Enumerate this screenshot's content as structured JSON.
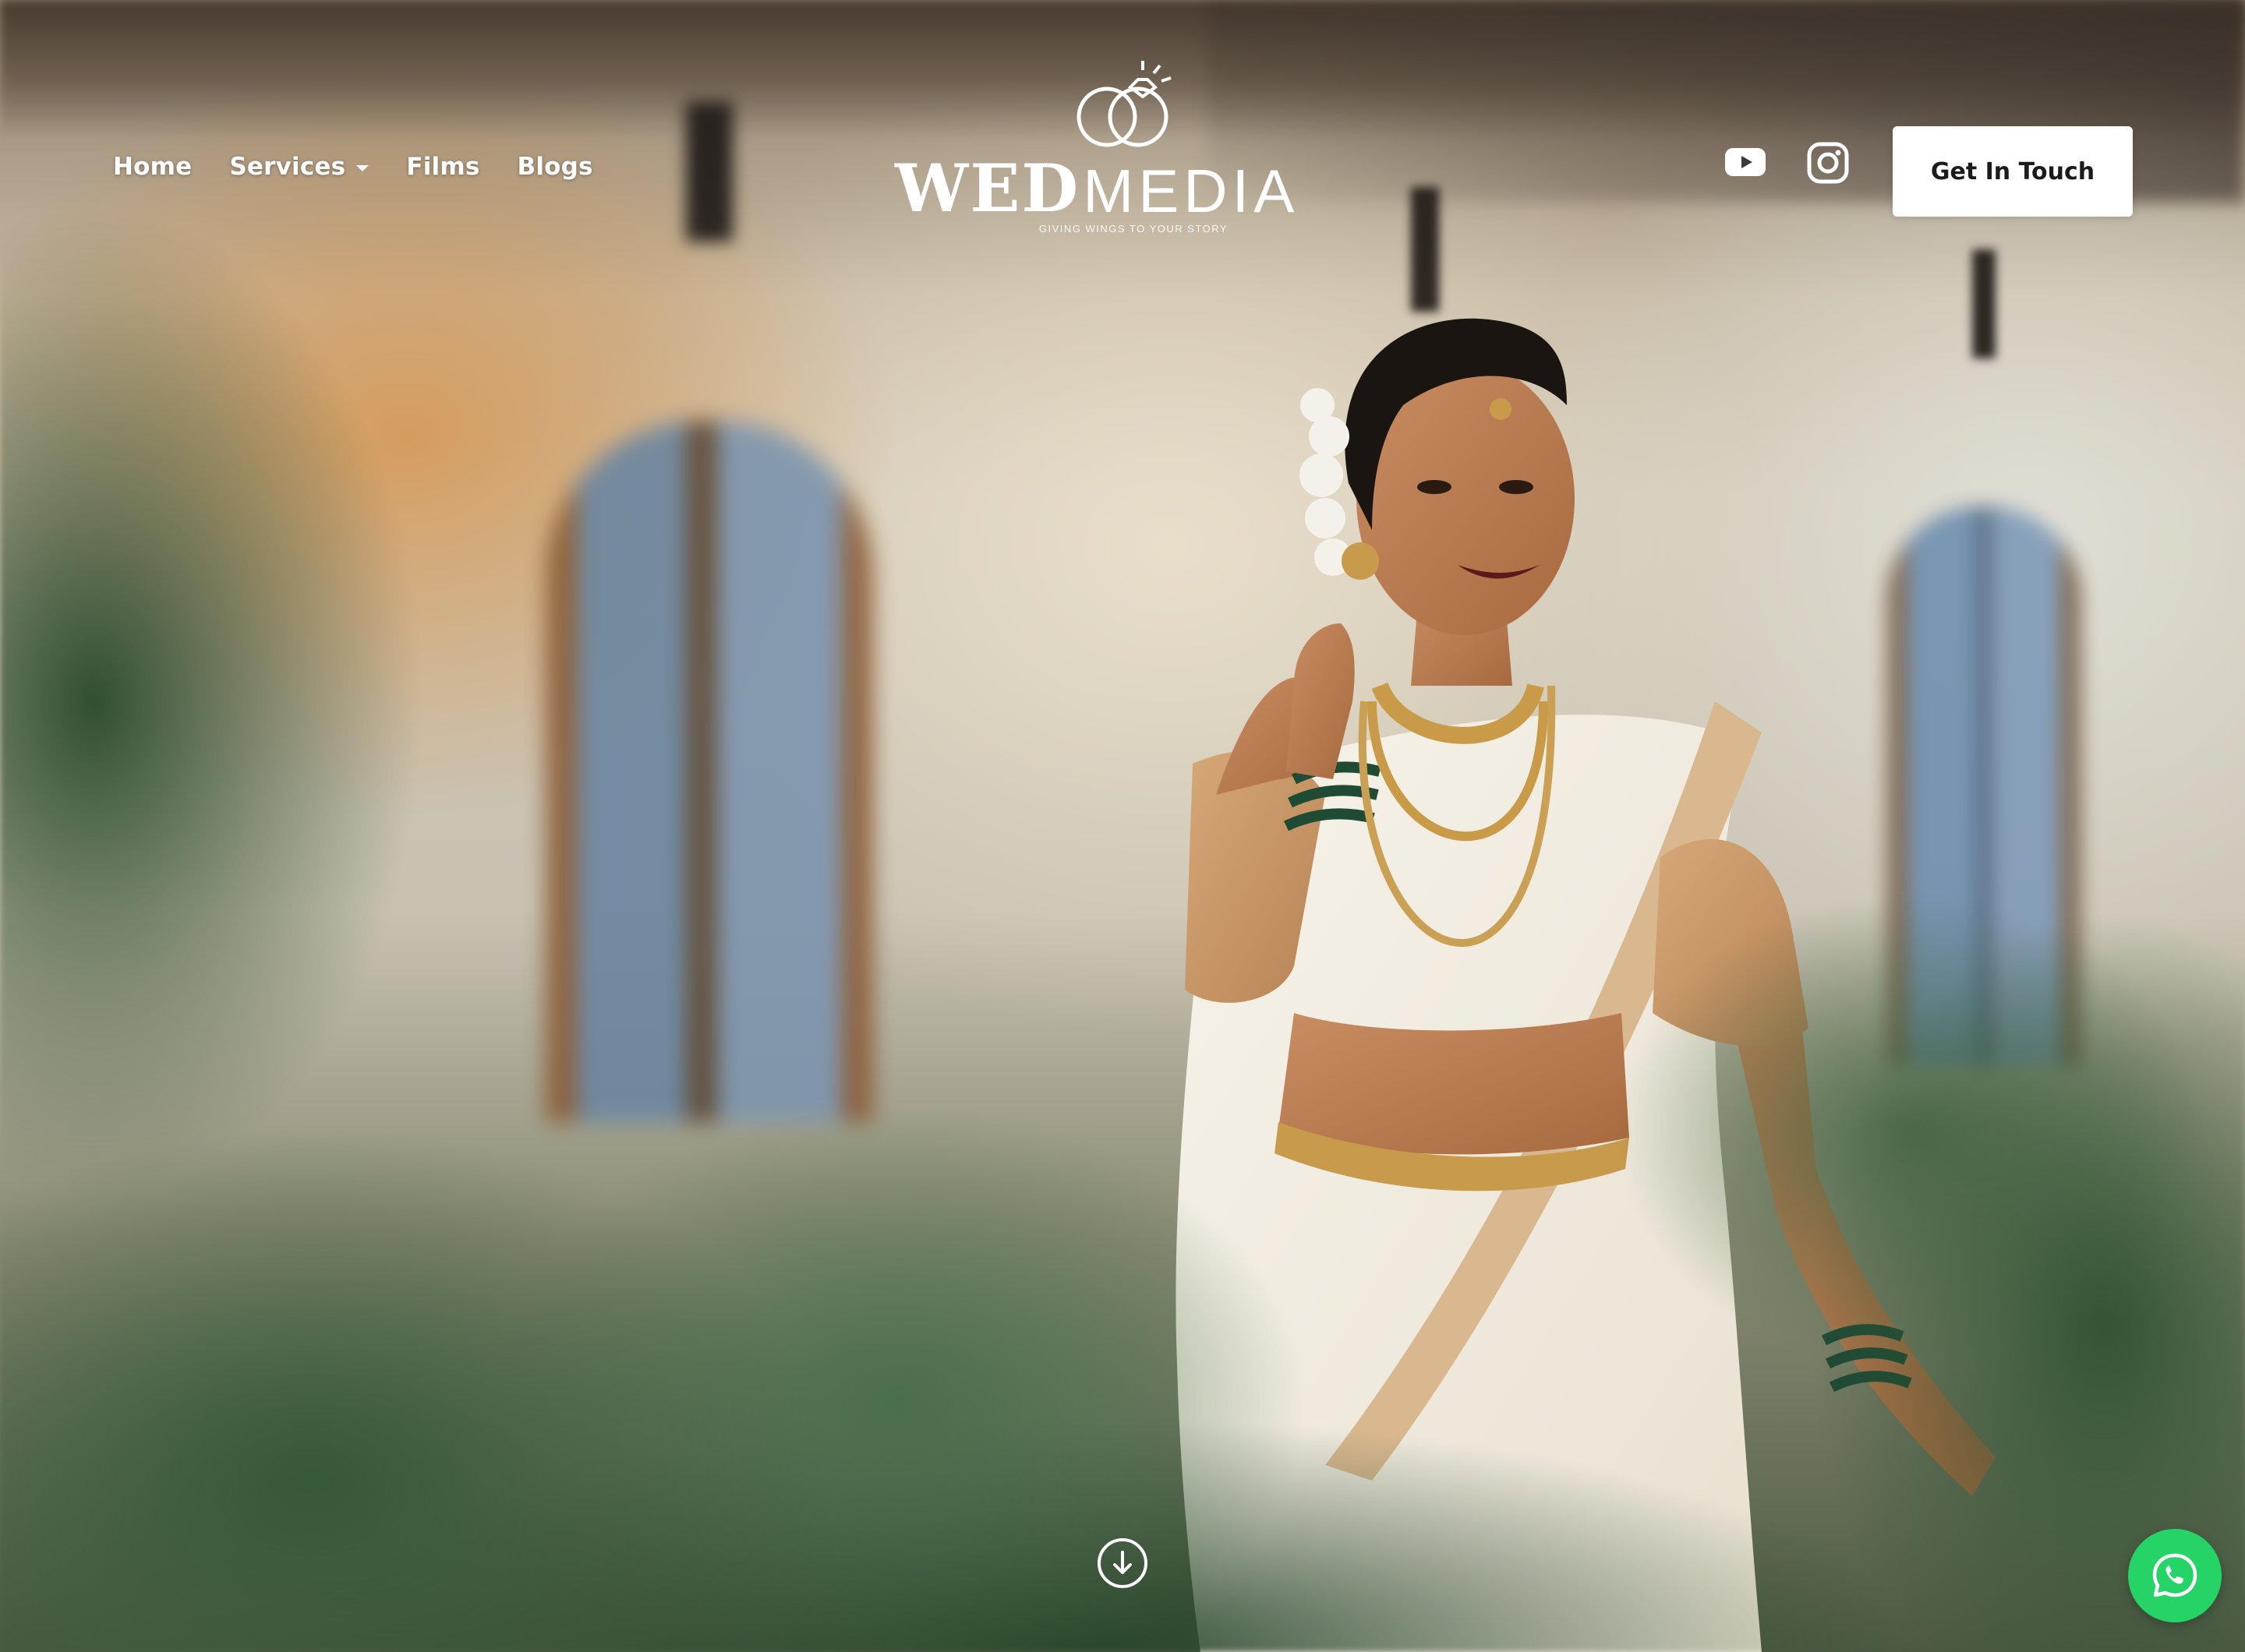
{
  "nav": {
    "home": "Home",
    "services": "Services",
    "films": "Films",
    "blogs": "Blogs"
  },
  "logo": {
    "word_bold": "WED",
    "word_thin": "MEDIA",
    "tagline": "GIVING WINGS TO YOUR STORY"
  },
  "social": {
    "youtube_icon": "youtube-icon",
    "instagram_icon": "instagram-icon"
  },
  "cta": {
    "label": "Get In Touch"
  },
  "floating": {
    "scroll_icon": "arrow-down-circle-icon",
    "whatsapp_icon": "whatsapp-icon",
    "whatsapp_color": "#25d366"
  }
}
